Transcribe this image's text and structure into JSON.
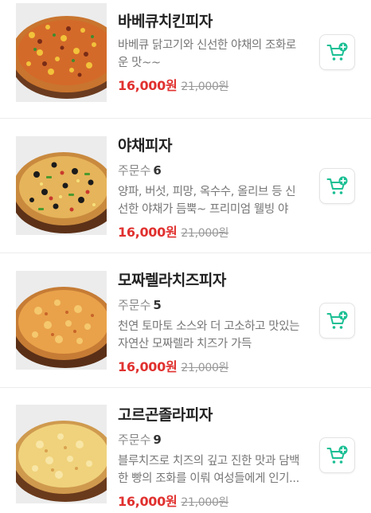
{
  "accent_color": "#1bbf94",
  "price_color": "#e0312f",
  "orders_label": "주문수",
  "products": [
    {
      "name": "바베큐치킨피자",
      "orders": "",
      "description": "바베큐 닭고기와 신선한 야채의 조화로운 맛~~",
      "price": "16,000원",
      "original_price": "21,000원",
      "image_icon": "bbq-chicken-pizza-image",
      "cart_icon": "cart-add-icon"
    },
    {
      "name": "야채피자",
      "orders": "6",
      "description": "양파, 버섯, 피망, 옥수수, 올리브 등 신선한 야채가 듬뿍~ 프리미엄 웰빙 야채...",
      "price": "16,000원",
      "original_price": "21,000원",
      "image_icon": "vegetable-pizza-image",
      "cart_icon": "cart-add-icon"
    },
    {
      "name": "모짜렐라치즈피자",
      "orders": "5",
      "description": "천연 토마토 소스와 더 고소하고 맛있는 자연산 모짜렐라 치즈가 가득",
      "price": "16,000원",
      "original_price": "21,000원",
      "image_icon": "mozzarella-cheese-pizza-image",
      "cart_icon": "cart-add-icon"
    },
    {
      "name": "고르곤졸라피자",
      "orders": "9",
      "description": "블루치즈로 치즈의 깊고 진한 맛과 담백한 빵의 조화를 이뤄 여성들에게 인기...",
      "price": "16,000원",
      "original_price": "21,000원",
      "image_icon": "gorgonzola-pizza-image",
      "cart_icon": "cart-add-icon"
    }
  ]
}
